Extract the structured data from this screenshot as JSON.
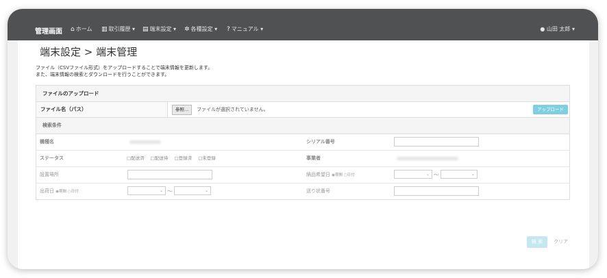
{
  "navbar": {
    "brand": "管理画面",
    "items": [
      {
        "icon": "home-icon",
        "glyph": "⌂",
        "label": "ホーム"
      },
      {
        "icon": "chart-icon",
        "glyph": "▥",
        "label": "取引履歴 ▾"
      },
      {
        "icon": "device-icon",
        "glyph": "▤",
        "label": "端末設定 ▾"
      },
      {
        "icon": "gear-icon",
        "glyph": "✲",
        "label": "各種設定 ▾"
      },
      {
        "icon": "help-icon",
        "glyph": "?",
        "label": "マニュアル ▾"
      }
    ],
    "user": {
      "icon": "user-icon",
      "glyph": "●",
      "label": "山田 太郎 ▾"
    }
  },
  "page": {
    "title": "端末設定 > 端末管理",
    "desc_line1": "ファイル（CSVファイル形式）をアップロードすることで端末情報を更新します。",
    "desc_line2": "また、端末情報の検索とダウンロードを行うことができます。"
  },
  "upload_panel": {
    "heading": "ファイルのアップロード",
    "file_label": "ファイル名（パス）",
    "browse_label": "参照...",
    "file_status": "ファイルが選択されていません。",
    "upload_label": "アップロード"
  },
  "search": {
    "heading": "検索条件",
    "model_label": "機種名",
    "serial_label": "シリアル番号",
    "status_label": "ステータス",
    "status_options": [
      "□配送済",
      "□配送待",
      "□登録済",
      "□未登録"
    ],
    "operator_label": "事業者",
    "location_label": "設置場所",
    "delivery_label": "納品希望日",
    "delivery_radios": "◉期間 ○日付",
    "ship_label": "出荷日",
    "ship_radios": "◉期間 ○日付",
    "tracking_label": "送り状番号",
    "tilde": "〜",
    "select_arrow": "⌄",
    "search_button": "検 索",
    "clear_button": "クリア"
  }
}
